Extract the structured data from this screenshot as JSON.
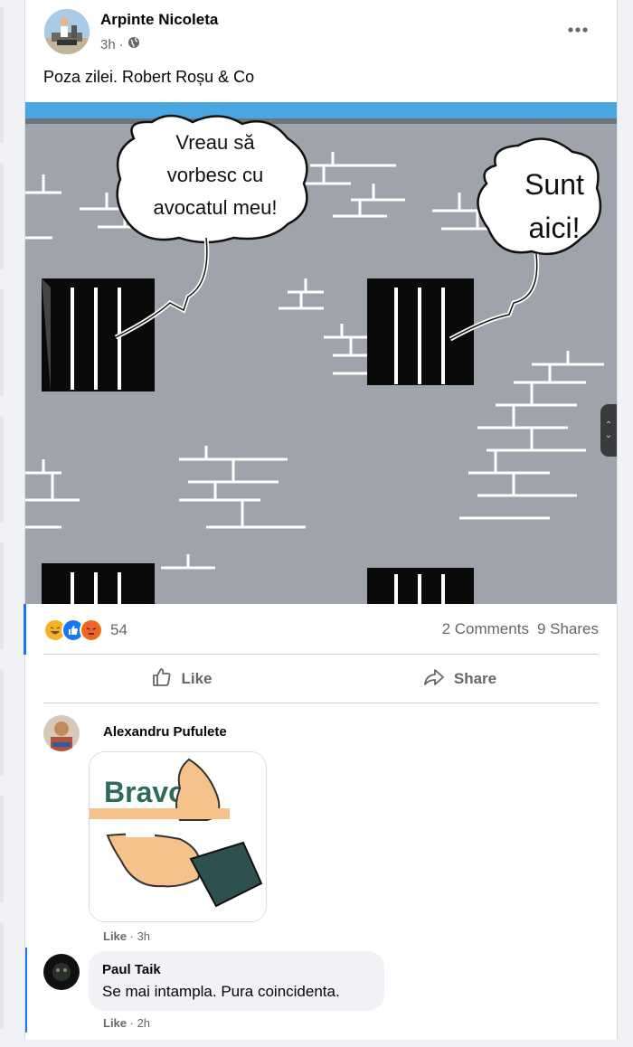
{
  "post": {
    "author": "Arpinte Nicoleta",
    "time": "3h",
    "privacy_icon": "globe-icon",
    "text": "Poza zilei. Robert Roșu & Co",
    "image": {
      "bubble_left": [
        "Vreau să",
        "vorbesc cu",
        "avocatul meu!"
      ],
      "bubble_right": [
        "Sunt",
        "aici!"
      ]
    }
  },
  "stats": {
    "reaction_icons": [
      "haha-icon",
      "like-icon",
      "angry-icon"
    ],
    "reaction_count": "54",
    "comments": "2 Comments",
    "shares": "9 Shares"
  },
  "actions": {
    "like": "Like",
    "share": "Share"
  },
  "comments": [
    {
      "author": "Alexandru Pufulete",
      "sticker_text": "Bravo",
      "like": "Like",
      "time": "3h"
    },
    {
      "author": "Paul Taik",
      "text": "Se mai intampla. Pura coincidenta.",
      "like": "Like",
      "time": "2h"
    }
  ],
  "colors": {
    "accent": "#1877f2",
    "secondary_text": "#65676b",
    "wall": "#9fa3ab",
    "sky": "#4aa6e0"
  }
}
